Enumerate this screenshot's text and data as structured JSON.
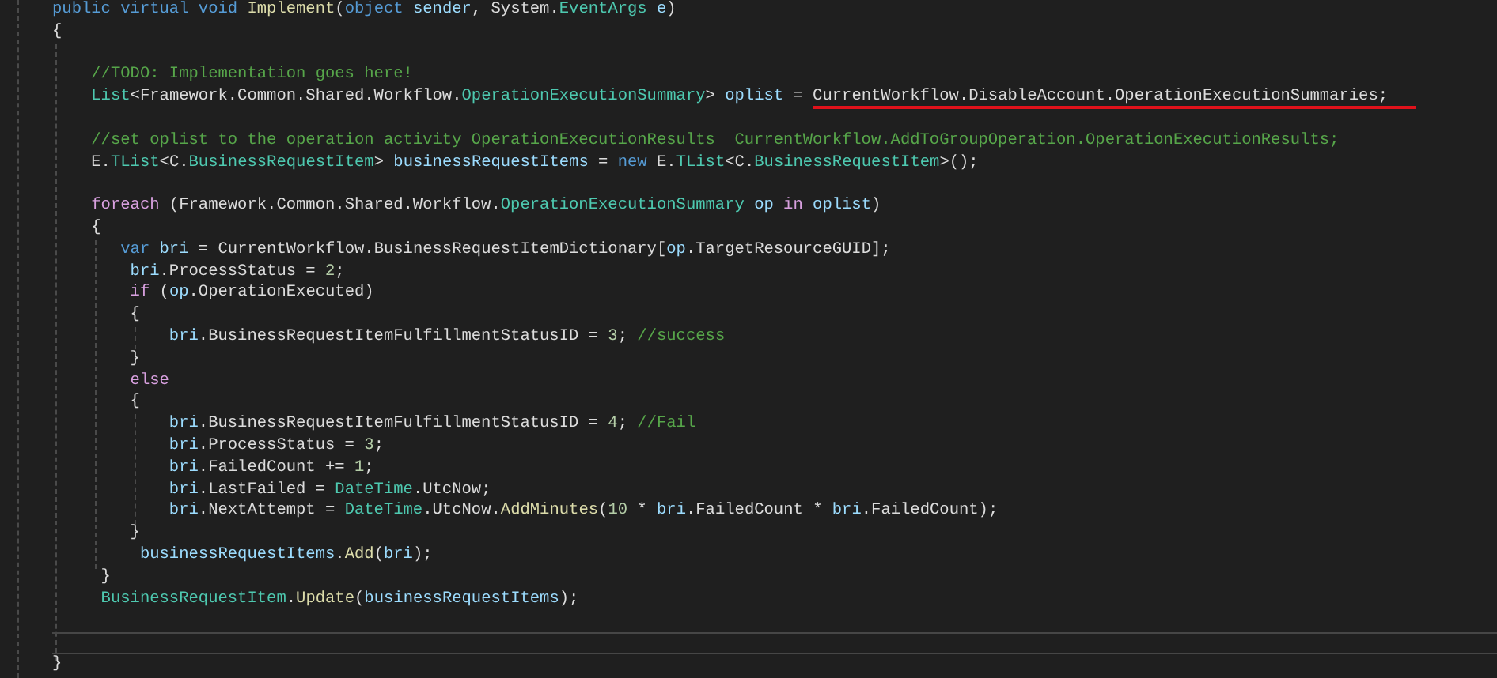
{
  "editor": {
    "lines": [
      {
        "current": false,
        "tokens": [
          {
            "kind": "keyword",
            "text": "public virtual void "
          },
          {
            "kind": "method",
            "text": "Implement"
          },
          {
            "kind": "plain",
            "text": "("
          },
          {
            "kind": "keyword",
            "text": "object "
          },
          {
            "kind": "variable",
            "text": "sender"
          },
          {
            "kind": "plain",
            "text": ", System."
          },
          {
            "kind": "type",
            "text": "EventArgs"
          },
          {
            "kind": "variable",
            "text": " e"
          },
          {
            "kind": "plain",
            "text": ")"
          }
        ]
      },
      {
        "current": false,
        "tokens": [
          {
            "kind": "plain",
            "text": "{"
          }
        ]
      },
      {
        "current": false
      },
      {
        "current": false,
        "tokens": [
          {
            "kind": "comment",
            "text": "    //TODO: Implementation goes here!"
          }
        ]
      },
      {
        "current": false,
        "tokens": [
          {
            "kind": "type",
            "text": "    List"
          },
          {
            "kind": "plain",
            "text": "<Framework.Common.Shared.Workflow."
          },
          {
            "kind": "type",
            "text": "OperationExecutionSummary"
          },
          {
            "kind": "plain",
            "text": "> "
          },
          {
            "kind": "variable",
            "text": "oplist"
          },
          {
            "kind": "plain",
            "text": " = "
          },
          {
            "kind": "plain",
            "text": "CurrentWorkflow.DisableAccount.OperationExecutionSummaries;",
            "underlined": true
          }
        ]
      },
      {
        "current": false
      },
      {
        "current": false,
        "tokens": [
          {
            "kind": "comment",
            "text": "    //set oplist to the operation activity OperationExecutionResults  CurrentWorkflow.AddToGroupOperation.OperationExecutionResults;"
          }
        ]
      },
      {
        "current": false,
        "tokens": [
          {
            "kind": "plain",
            "text": "    E."
          },
          {
            "kind": "type",
            "text": "TList"
          },
          {
            "kind": "plain",
            "text": "<C."
          },
          {
            "kind": "type",
            "text": "BusinessRequestItem"
          },
          {
            "kind": "plain",
            "text": "> "
          },
          {
            "kind": "variable",
            "text": "businessRequestItems"
          },
          {
            "kind": "plain",
            "text": " = "
          },
          {
            "kind": "keyword",
            "text": "new"
          },
          {
            "kind": "plain",
            "text": " E."
          },
          {
            "kind": "type",
            "text": "TList"
          },
          {
            "kind": "plain",
            "text": "<C."
          },
          {
            "kind": "type",
            "text": "BusinessRequestItem"
          },
          {
            "kind": "plain",
            "text": ">();"
          }
        ]
      },
      {
        "current": false
      },
      {
        "current": false,
        "tokens": [
          {
            "kind": "control",
            "text": "    foreach"
          },
          {
            "kind": "plain",
            "text": " (Framework.Common.Shared.Workflow."
          },
          {
            "kind": "type",
            "text": "OperationExecutionSummary"
          },
          {
            "kind": "variable",
            "text": " op"
          },
          {
            "kind": "control",
            "text": " in"
          },
          {
            "kind": "variable",
            "text": " oplist"
          },
          {
            "kind": "plain",
            "text": ")"
          }
        ]
      },
      {
        "current": false,
        "tokens": [
          {
            "kind": "plain",
            "text": "    {"
          }
        ]
      },
      {
        "current": false,
        "tokens": [
          {
            "kind": "keyword",
            "text": "       var"
          },
          {
            "kind": "variable",
            "text": " bri"
          },
          {
            "kind": "plain",
            "text": " = CurrentWorkflow.BusinessRequestItemDictionary["
          },
          {
            "kind": "variable",
            "text": "op"
          },
          {
            "kind": "plain",
            "text": ".TargetResourceGUID];"
          }
        ]
      },
      {
        "current": false,
        "tokens": [
          {
            "kind": "variable",
            "text": "        bri"
          },
          {
            "kind": "plain",
            "text": ".ProcessStatus = "
          },
          {
            "kind": "number",
            "text": "2"
          },
          {
            "kind": "plain",
            "text": ";"
          }
        ]
      },
      {
        "current": false,
        "tokens": [
          {
            "kind": "control",
            "text": "        if"
          },
          {
            "kind": "plain",
            "text": " ("
          },
          {
            "kind": "variable",
            "text": "op"
          },
          {
            "kind": "plain",
            "text": ".OperationExecuted)"
          }
        ]
      },
      {
        "current": false,
        "tokens": [
          {
            "kind": "plain",
            "text": "        {"
          }
        ]
      },
      {
        "current": false,
        "tokens": [
          {
            "kind": "variable",
            "text": "            bri"
          },
          {
            "kind": "plain",
            "text": ".BusinessRequestItemFulfillmentStatusID = "
          },
          {
            "kind": "number",
            "text": "3"
          },
          {
            "kind": "plain",
            "text": "; "
          },
          {
            "kind": "comment",
            "text": "//success"
          }
        ]
      },
      {
        "current": false,
        "tokens": [
          {
            "kind": "plain",
            "text": "        }"
          }
        ]
      },
      {
        "current": false,
        "tokens": [
          {
            "kind": "control",
            "text": "        else"
          }
        ]
      },
      {
        "current": false,
        "tokens": [
          {
            "kind": "plain",
            "text": "        {"
          }
        ]
      },
      {
        "current": false,
        "tokens": [
          {
            "kind": "variable",
            "text": "            bri"
          },
          {
            "kind": "plain",
            "text": ".BusinessRequestItemFulfillmentStatusID = "
          },
          {
            "kind": "number",
            "text": "4"
          },
          {
            "kind": "plain",
            "text": "; "
          },
          {
            "kind": "comment",
            "text": "//Fail"
          }
        ]
      },
      {
        "current": false,
        "tokens": [
          {
            "kind": "variable",
            "text": "            bri"
          },
          {
            "kind": "plain",
            "text": ".ProcessStatus = "
          },
          {
            "kind": "number",
            "text": "3"
          },
          {
            "kind": "plain",
            "text": ";"
          }
        ]
      },
      {
        "current": false,
        "tokens": [
          {
            "kind": "variable",
            "text": "            bri"
          },
          {
            "kind": "plain",
            "text": ".FailedCount += "
          },
          {
            "kind": "number",
            "text": "1"
          },
          {
            "kind": "plain",
            "text": ";"
          }
        ]
      },
      {
        "current": false,
        "tokens": [
          {
            "kind": "variable",
            "text": "            bri"
          },
          {
            "kind": "plain",
            "text": ".LastFailed = "
          },
          {
            "kind": "type",
            "text": "DateTime"
          },
          {
            "kind": "plain",
            "text": ".UtcNow;"
          }
        ]
      },
      {
        "current": false,
        "tokens": [
          {
            "kind": "variable",
            "text": "            bri"
          },
          {
            "kind": "plain",
            "text": ".NextAttempt = "
          },
          {
            "kind": "type",
            "text": "DateTime"
          },
          {
            "kind": "plain",
            "text": ".UtcNow."
          },
          {
            "kind": "method",
            "text": "AddMinutes"
          },
          {
            "kind": "plain",
            "text": "("
          },
          {
            "kind": "number",
            "text": "10"
          },
          {
            "kind": "plain",
            "text": " * "
          },
          {
            "kind": "variable",
            "text": "bri"
          },
          {
            "kind": "plain",
            "text": ".FailedCount * "
          },
          {
            "kind": "variable",
            "text": "bri"
          },
          {
            "kind": "plain",
            "text": ".FailedCount);"
          }
        ]
      },
      {
        "current": false,
        "tokens": [
          {
            "kind": "plain",
            "text": "        }"
          }
        ]
      },
      {
        "current": false,
        "tokens": [
          {
            "kind": "variable",
            "text": "         businessRequestItems"
          },
          {
            "kind": "plain",
            "text": "."
          },
          {
            "kind": "method",
            "text": "Add"
          },
          {
            "kind": "plain",
            "text": "("
          },
          {
            "kind": "variable",
            "text": "bri"
          },
          {
            "kind": "plain",
            "text": ");"
          }
        ]
      },
      {
        "current": false,
        "tokens": [
          {
            "kind": "plain",
            "text": "     }"
          }
        ]
      },
      {
        "current": false,
        "tokens": [
          {
            "kind": "type",
            "text": "     BusinessRequestItem"
          },
          {
            "kind": "plain",
            "text": "."
          },
          {
            "kind": "method",
            "text": "Update"
          },
          {
            "kind": "plain",
            "text": "("
          },
          {
            "kind": "variable",
            "text": "businessRequestItems"
          },
          {
            "kind": "plain",
            "text": ");"
          }
        ]
      },
      {
        "current": false
      },
      {
        "current": true
      },
      {
        "current": false,
        "tokens": [
          {
            "kind": "plain",
            "text": "}"
          }
        ]
      }
    ]
  }
}
